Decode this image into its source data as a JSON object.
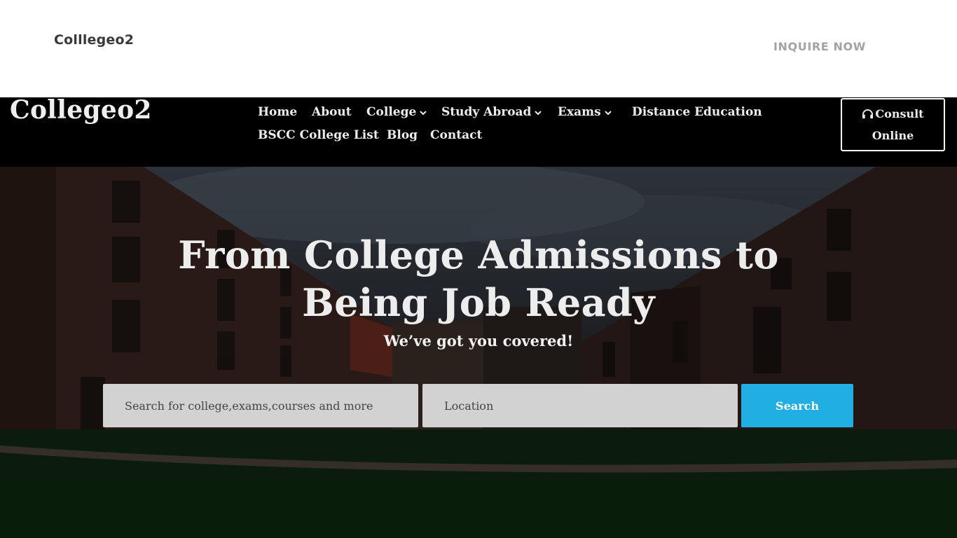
{
  "topbar": {
    "brand": "Colllegeo2",
    "inquire_label": "INQUIRE NOW"
  },
  "navbar": {
    "logo": "Collegeo2",
    "items": [
      {
        "label": "Home"
      },
      {
        "label": "About"
      },
      {
        "label": "College",
        "icon": "chevron-down-icon"
      },
      {
        "label": "Study Abroad",
        "icon": "chevron-down-icon"
      },
      {
        "label": "Exams",
        "icon": "chevron-down-icon"
      },
      {
        "label": "Distance Education"
      },
      {
        "label": "BSCC College List"
      },
      {
        "label": "Blog"
      },
      {
        "label": "Contact"
      }
    ],
    "consult": {
      "icon": "headphones-icon",
      "line1": "Consult",
      "line2": "Online"
    }
  },
  "hero": {
    "title_line1": "From College Admissions to",
    "title_line2": "Being Job Ready",
    "subtitle": "We’ve got you covered!",
    "search": {
      "query_placeholder": "Search for college,exams,courses and more",
      "location_placeholder": "Location",
      "button_label": "Search"
    }
  },
  "colors": {
    "accent": "#20aee3",
    "nav_bg": "#000000",
    "field_bg": "#d2d2d2"
  }
}
